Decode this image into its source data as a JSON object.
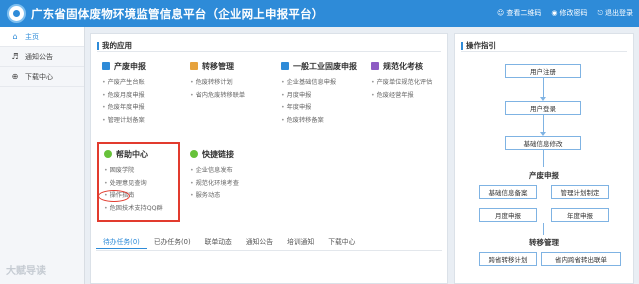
{
  "header": {
    "title": "广东省固体废物环境监管信息平台（企业网上申报平台）",
    "actions": [
      {
        "label": "查看二维码",
        "icon": "user-icon"
      },
      {
        "label": "修改密码",
        "icon": "lock-icon"
      },
      {
        "label": "退出登录",
        "icon": "logout-icon"
      }
    ]
  },
  "sidebar": {
    "items": [
      {
        "label": "主页",
        "icon": "home-icon",
        "active": true
      },
      {
        "label": "通知公告",
        "icon": "speaker-icon",
        "active": false
      },
      {
        "label": "下载中心",
        "icon": "download-icon",
        "active": false
      }
    ]
  },
  "main": {
    "title": "我的应用",
    "modules": [
      {
        "title": "产废申报",
        "icon_color": "#2e8bd8",
        "items": [
          "产废产生台账",
          "危废月度申报",
          "危废年度申报",
          "管理计划备案"
        ]
      },
      {
        "title": "转移管理",
        "icon_color": "#e6a23c",
        "items": [
          "危废转移计划",
          "省内危废转移联单"
        ]
      },
      {
        "title": "一般工业固废申报",
        "icon_color": "#2e8bd8",
        "items": [
          "企业基础信息申报",
          "月度申报",
          "年度申报",
          "危废转移备案"
        ]
      },
      {
        "title": "规范化考核",
        "icon_color": "#8e5cc4",
        "items": [
          "产废单位规范化评估",
          "危废经营年报"
        ]
      },
      {
        "title": "帮助中心",
        "icon_color": "#67c23a",
        "items": [
          "固废学院",
          "处理意见查询",
          "操作指南",
          "危固技术支持QQ群"
        ]
      },
      {
        "title": "快捷链接",
        "icon_color": "#67c23a",
        "items": [
          "企业信息发布",
          "规范化环境考查",
          "服务动态"
        ]
      }
    ],
    "tabs": [
      "待办任务(0)",
      "已办任务(0)",
      "联单动态",
      "通知公告",
      "培训通知",
      "下载中心"
    ]
  },
  "guide": {
    "title": "操作指引",
    "steps": [
      "用户注册",
      "用户登录",
      "基础信息修改"
    ],
    "groups": [
      {
        "label": "产废申报",
        "rows": [
          [
            "基础信息备案",
            "管理计划制定"
          ],
          [
            "月度申报",
            "年度申报"
          ]
        ]
      },
      {
        "label": "转移管理",
        "rows": [
          [
            "跨省转移计划",
            "省内跨省转出联单"
          ]
        ]
      }
    ]
  },
  "watermark": "大赋导读"
}
